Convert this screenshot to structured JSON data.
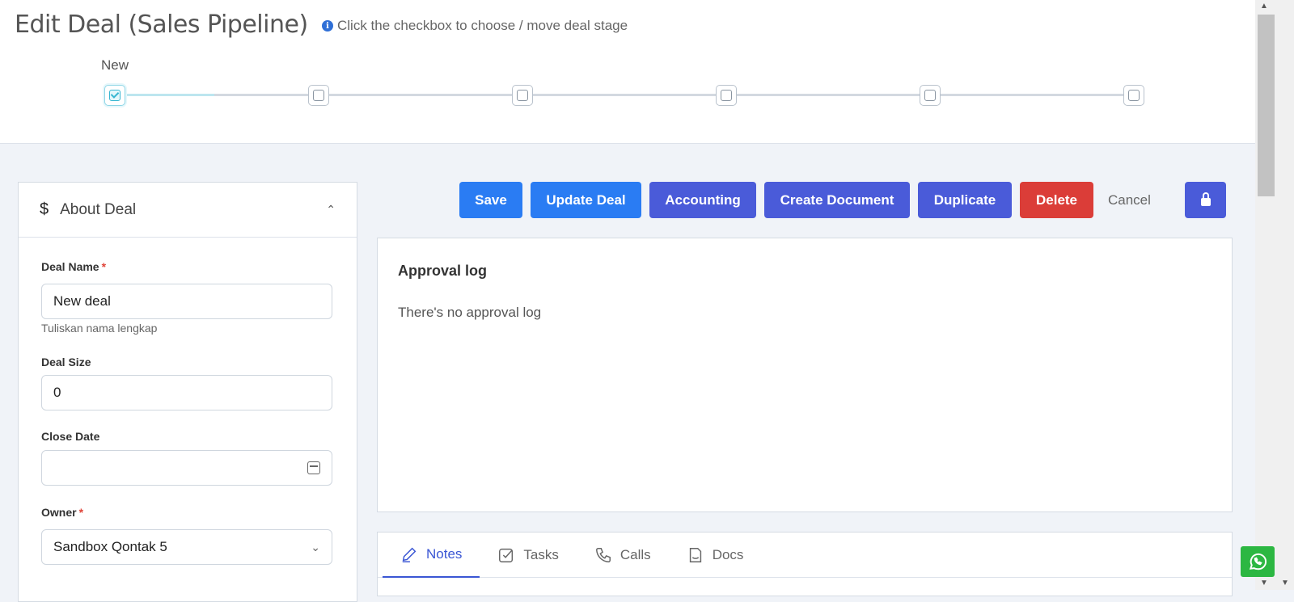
{
  "header": {
    "title": "Edit Deal (Sales Pipeline)",
    "hint": "Click the checkbox to choose / move deal stage",
    "hint_icon": "info-circle-icon"
  },
  "pipeline": {
    "current_stage_label": "New",
    "stages": [
      {
        "checked": true
      },
      {
        "checked": false
      },
      {
        "checked": false
      },
      {
        "checked": false
      },
      {
        "checked": false
      },
      {
        "checked": false
      }
    ]
  },
  "about": {
    "title": "About Deal",
    "icon": "dollar-icon",
    "collapse_icon": "chevron-double-up-icon",
    "deal_name": {
      "label": "Deal Name",
      "required": "*",
      "value": "New deal",
      "help": "Tuliskan nama lengkap"
    },
    "deal_size": {
      "label": "Deal Size",
      "value": "0"
    },
    "close_date": {
      "label": "Close Date",
      "value": ""
    },
    "owner": {
      "label": "Owner",
      "required": "*",
      "value": "Sandbox Qontak 5"
    }
  },
  "actions": {
    "save": "Save",
    "update": "Update Deal",
    "accounting": "Accounting",
    "create_document": "Create Document",
    "duplicate": "Duplicate",
    "delete": "Delete",
    "cancel": "Cancel",
    "lock_icon": "lock-icon",
    "colors": {
      "primary": "#2a7cf3",
      "indigo": "#4a5bd9",
      "danger": "#db3d38"
    }
  },
  "approval": {
    "title": "Approval log",
    "empty": "There's no approval log"
  },
  "tabs": [
    {
      "label": "Notes",
      "icon": "pencil-icon",
      "active": true
    },
    {
      "label": "Tasks",
      "icon": "checkbox-icon",
      "active": false
    },
    {
      "label": "Calls",
      "icon": "phone-icon",
      "active": false
    },
    {
      "label": "Docs",
      "icon": "document-icon",
      "active": false
    }
  ]
}
